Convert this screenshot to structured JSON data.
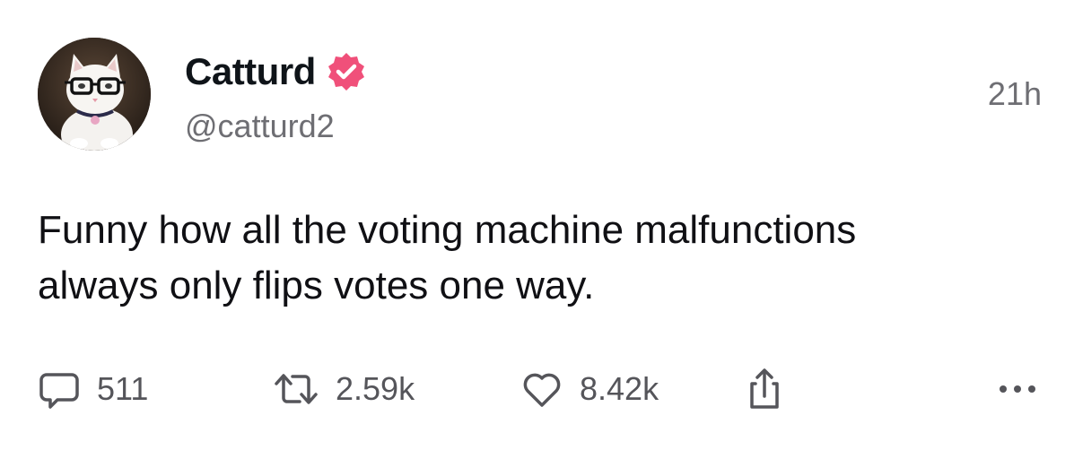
{
  "author": {
    "display_name": "Catturd",
    "handle": "@catturd2",
    "verified": true,
    "verified_color": "#f0507a",
    "avatar": "white-cat-with-glasses"
  },
  "timestamp": "21h",
  "post": {
    "text_line1": "Funny how all the voting machine malfunctions",
    "text_line2": "always only flips votes one way."
  },
  "actions": {
    "reply": {
      "icon": "speech-bubble-icon",
      "count": "511"
    },
    "repost": {
      "icon": "repost-arrows-icon",
      "count": "2.59k"
    },
    "like": {
      "icon": "heart-icon",
      "count": "8.42k"
    },
    "share": {
      "icon": "share-icon"
    },
    "more": {
      "icon": "more-dots-icon"
    }
  },
  "colors": {
    "text_primary": "#0f1419",
    "text_secondary": "#6e6e73",
    "icon": "#55555a"
  }
}
